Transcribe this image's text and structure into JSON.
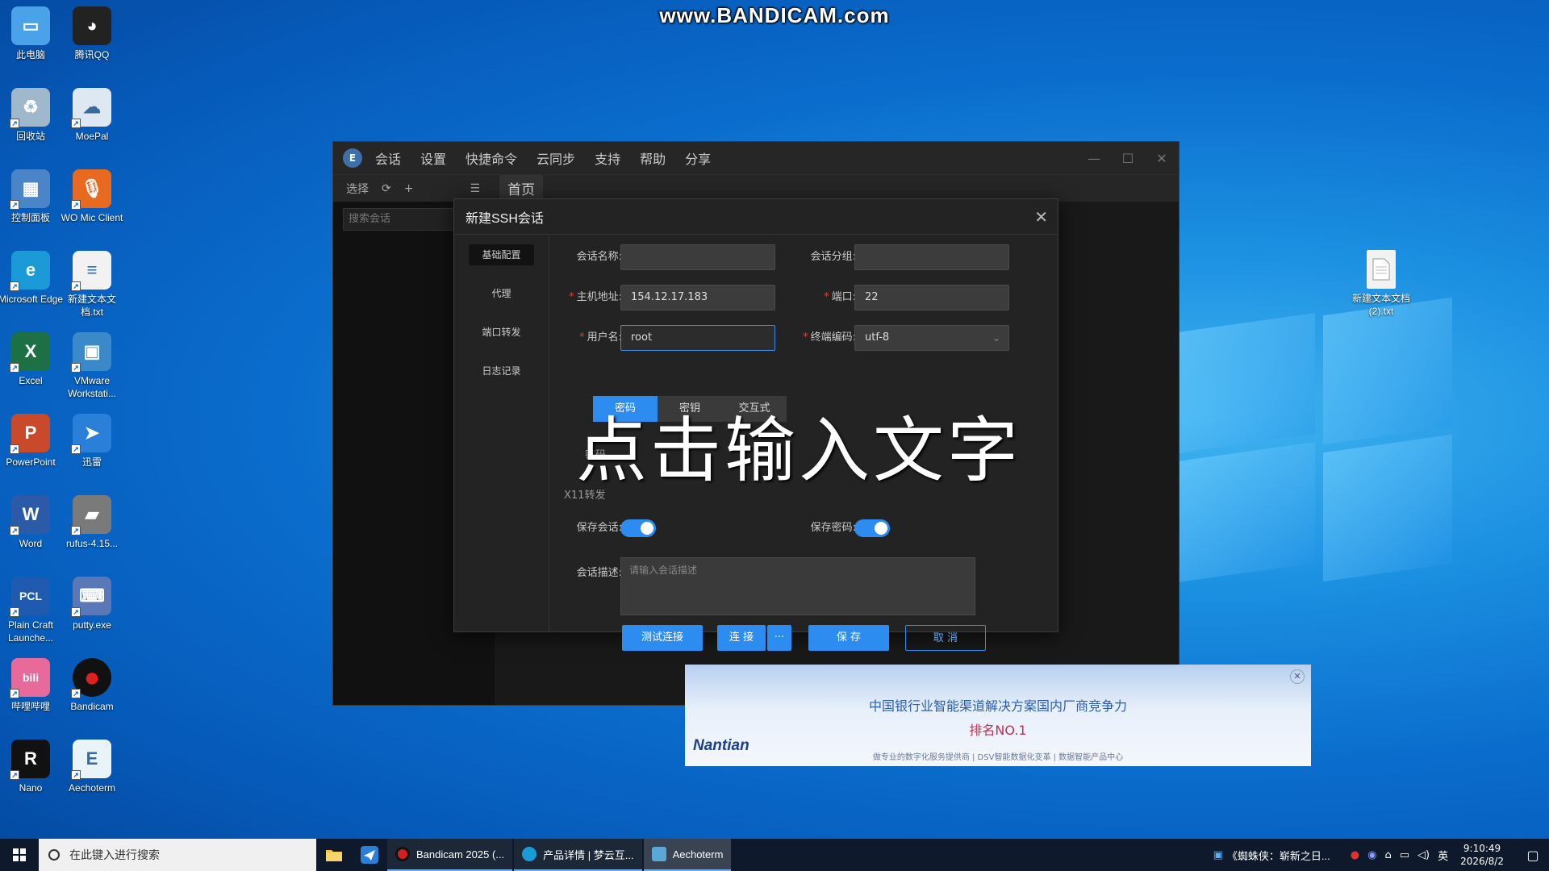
{
  "watermark": "www.BANDICAM.com",
  "desktop_icons": [
    {
      "label": "此电脑",
      "icon": "computer-icon",
      "color": "#4aa3e8"
    },
    {
      "label": "腾讯QQ",
      "icon": "qq-penguin-icon",
      "color": "#222222"
    },
    {
      "label": "回收站",
      "icon": "recycle-bin-icon",
      "color": "#9fb8cc"
    },
    {
      "label": "MoePal",
      "icon": "moepal-cloud-icon",
      "color": "#dde8f2"
    },
    {
      "label": "控制面板",
      "icon": "control-panel-icon",
      "color": "#4a86c7"
    },
    {
      "label": "WO Mic Client",
      "icon": "microphone-icon",
      "color": "#e86a20"
    },
    {
      "label": "Microsoft Edge",
      "icon": "edge-icon",
      "color": "#1a9ad6"
    },
    {
      "label": "新建文本文档.txt",
      "icon": "text-file-icon",
      "color": "#f2f2f2"
    },
    {
      "label": "Excel",
      "icon": "excel-icon",
      "color": "#1d7044"
    },
    {
      "label": "VMware Workstati...",
      "icon": "vmware-icon",
      "color": "#3a89c9"
    },
    {
      "label": "PowerPoint",
      "icon": "powerpoint-icon",
      "color": "#c94a2a"
    },
    {
      "label": "迅雷",
      "icon": "xunlei-bird-icon",
      "color": "#2a7fd8"
    },
    {
      "label": "Word",
      "icon": "word-icon",
      "color": "#2b5ba8"
    },
    {
      "label": "rufus-4.15...",
      "icon": "usb-drive-icon",
      "color": "#7a7a7a"
    },
    {
      "label": "Plain Craft Launche...",
      "icon": "pcl-icon",
      "color": "#1e5bb0"
    },
    {
      "label": "putty.exe",
      "icon": "putty-icon",
      "color": "#5a78b8"
    },
    {
      "label": "哔哩哔哩",
      "icon": "bilibili-icon",
      "color": "#e86a9a"
    },
    {
      "label": "Bandicam",
      "icon": "bandicam-record-icon",
      "color": "#111111"
    },
    {
      "label": "Nano",
      "icon": "nano-icon",
      "color": "#111111"
    },
    {
      "label": "Aechoterm",
      "icon": "aechoterm-icon",
      "color": "#e8f4f8"
    }
  ],
  "right_desktop_icon": {
    "label": "新建文本文档 (2).txt",
    "icon": "text-file-icon"
  },
  "app": {
    "menu": [
      "会话",
      "设置",
      "快捷命令",
      "云同步",
      "支持",
      "帮助",
      "分享"
    ],
    "toolbar": {
      "select": "选择",
      "home_tab": "首页"
    },
    "search_placeholder": "搜索会话",
    "ad": {
      "title": "中国银行业智能渠道解决方案国内厂商竞争力",
      "subtitle": "排名NO.1",
      "logo": "Nantian",
      "footer": "做专业的数字化服务提供商 | DSV智能数据化变革 | 数据智能产品中心"
    }
  },
  "modal": {
    "title": "新建SSH会话",
    "nav": [
      "基础配置",
      "代理",
      "端口转发",
      "日志记录"
    ],
    "fields": {
      "session_name_label": "会话名称:",
      "session_name_value": "",
      "session_group_label": "会话分组:",
      "session_group_value": "",
      "host_label": "主机地址:",
      "host_value": "154.12.17.183",
      "port_label": "端口:",
      "port_value": "22",
      "username_label": "用户名:",
      "username_value": "root",
      "encoding_label": "终端编码:",
      "encoding_value": "utf-8"
    },
    "auth_tabs": [
      "密码",
      "密钥",
      "交互式"
    ],
    "partial_labels": {
      "password": "密码",
      "x11": "X11转发"
    },
    "overlay_text": "点击输入文字",
    "save_session_label": "保存会话:",
    "save_password_label": "保存密码:",
    "description_label": "会话描述:",
    "description_placeholder": "请输入会话描述",
    "buttons": {
      "test": "测试连接",
      "connect": "连 接",
      "more": "···",
      "save": "保 存",
      "cancel": "取 消"
    }
  },
  "taskbar": {
    "search_placeholder": "在此键入进行搜索",
    "tasks": [
      {
        "label": "Bandicam 2025 (...",
        "color": "#d02020"
      },
      {
        "label": "产品详情 | 梦云互...",
        "color": "#1a9ad6"
      },
      {
        "label": "Aechoterm",
        "color": "#5aa8d8"
      }
    ],
    "news": "《蜘蛛侠：崭新之日...",
    "ime": "英",
    "time": "9:10:49",
    "date": "2026/8/2"
  },
  "colors": {
    "accent": "#2d8cf0",
    "required": "#e04040"
  }
}
